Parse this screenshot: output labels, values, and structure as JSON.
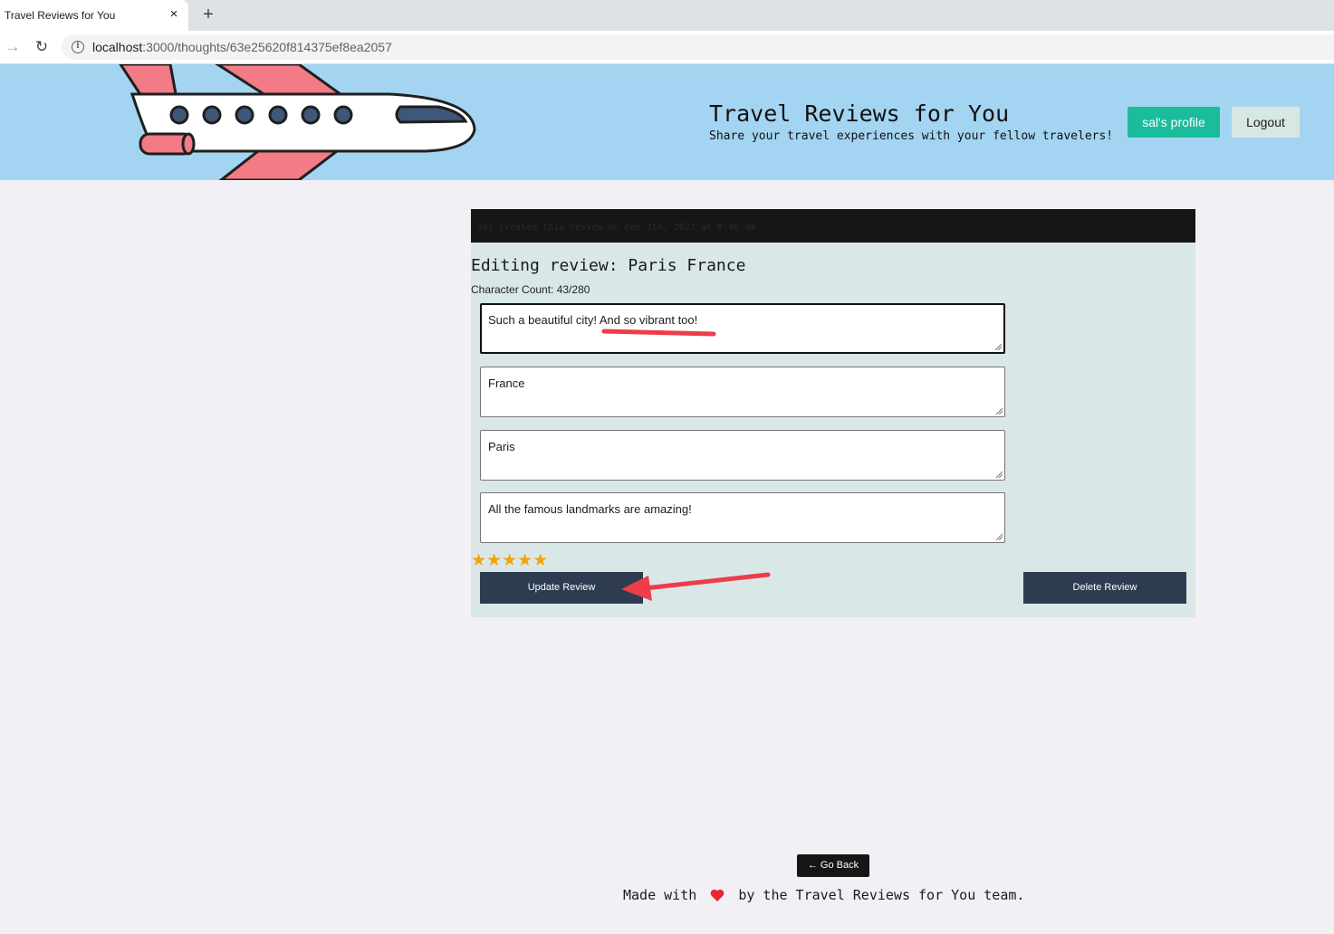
{
  "browser": {
    "tab_title": "Travel Reviews for You",
    "tab_close": "×",
    "new_tab": "+",
    "back_icon": "→",
    "reload_icon": "↻",
    "url_host": "localhost",
    "url_path": ":3000/thoughts/63e25620f814375ef8ea2057"
  },
  "header": {
    "title": "Travel Reviews for You",
    "subtitle": "Share your travel experiences with your fellow travelers!",
    "profile_button": "sal's profile",
    "logout_button": "Logout",
    "colors": {
      "background": "#a3d4f2",
      "profile": "#1bbc9b",
      "logout": "#d7e7e4"
    }
  },
  "review": {
    "meta": "sal created this review on Feb 7th, 2023 at 8:46 am",
    "edit_title": "Editing review: Paris France",
    "character_count": "Character Count: 43/280",
    "fields": {
      "thought_text": "Such a beautiful city!  And so vibrant too!",
      "country": "France",
      "city": "Paris",
      "detail": "All the famous landmarks are amazing!"
    },
    "rating": 5,
    "stars": "★★★★★",
    "update_button": "Update Review",
    "delete_button": "Delete Review"
  },
  "footer": {
    "go_back": "← Go Back",
    "made_with": "Made with",
    "by_team": "by the Travel Reviews for You team."
  }
}
